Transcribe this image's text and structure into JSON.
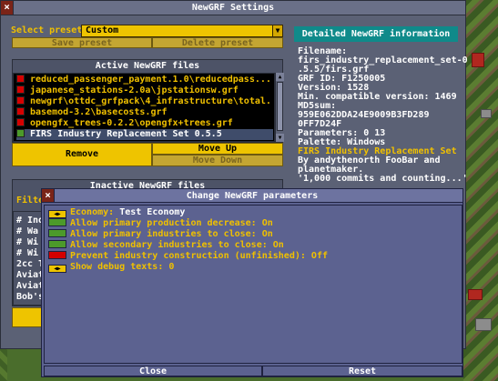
{
  "window": {
    "title": "NewGRF Settings",
    "close_glyph": "×"
  },
  "preset": {
    "label": "Select preset:",
    "value": "Custom",
    "save_label": "Save preset",
    "delete_label": "Delete preset"
  },
  "active": {
    "title": "Active NewGRF files",
    "items": [
      {
        "label": "reduced_passenger_payment.1.0\\reducedpass...",
        "status": "red"
      },
      {
        "label": "japanese_stations-2.0a\\jpstationsw.grf",
        "status": "red"
      },
      {
        "label": "newgrf\\ottdc_grfpack\\4_infrastructure\\total...",
        "status": "red"
      },
      {
        "label": "basemod-3.2\\basecosts.grf",
        "status": "red"
      },
      {
        "label": "opengfx_trees-0.2.2\\opengfx+trees.grf",
        "status": "red"
      },
      {
        "label": "FIRS Industry Replacement Set 0.5.5",
        "status": "green",
        "selected": true
      }
    ],
    "remove_label": "Remove",
    "move_up_label": "Move Up",
    "move_down_label": "Move Down"
  },
  "inactive": {
    "title": "Inactive NewGRF files",
    "filter_label": "Filter",
    "items": [
      "# Ind",
      "# Wa",
      "# Wi",
      "# Wi",
      "2cc T",
      "Aviat",
      "Aviat",
      "Bob's"
    ]
  },
  "info": {
    "title": "Detailed NewGRF information",
    "lines": [
      {
        "text": "Filename:",
        "style": "white"
      },
      {
        "text": "firs_industry_replacement_set-0",
        "style": "white"
      },
      {
        "text": ".5.5/firs.grf",
        "style": "white"
      },
      {
        "text": "GRF ID: F1250005",
        "style": "white"
      },
      {
        "text": "Version: 1528",
        "style": "white"
      },
      {
        "text": "Min. compatible version: 1469",
        "style": "white"
      },
      {
        "text": "MD5sum:",
        "style": "white"
      },
      {
        "text": "959E062DDA24E9009B3FD289",
        "style": "white"
      },
      {
        "text": "0FF7D24F",
        "style": "white"
      },
      {
        "text": "Parameters: 0 13",
        "style": "white"
      },
      {
        "text": "Palette: Windows",
        "style": "white"
      },
      {
        "text": "FIRS Industry Replacement Set",
        "style": "yellow"
      },
      {
        "text": "By andythenorth FooBar and",
        "style": "white"
      },
      {
        "text": "planetmaker.",
        "style": "white"
      },
      {
        "text": "'1,000 commits and counting...'",
        "style": "white"
      }
    ]
  },
  "params": {
    "title": "Change NewGRF parameters",
    "items": [
      {
        "name": "Economy:",
        "value": "Test Economy",
        "kind": "arrows"
      },
      {
        "name": "Allow primary production decrease:",
        "value": "On",
        "kind": "toggle",
        "color": "#4c9a2a"
      },
      {
        "name": "Allow primary industries to close:",
        "value": "On",
        "kind": "toggle",
        "color": "#4c9a2a"
      },
      {
        "name": "Allow secondary industries to close:",
        "value": "On",
        "kind": "toggle",
        "color": "#4c9a2a"
      },
      {
        "name": "Prevent industry construction (unfinished):",
        "value": "Off",
        "kind": "toggle",
        "color": "#d40000"
      },
      {
        "name": "Show debug texts:",
        "value": "0",
        "kind": "arrows"
      }
    ],
    "close_label": "Close",
    "reset_label": "Reset",
    "arrows_glyph": "◀▶"
  },
  "colors": {
    "accent_yellow": "#f0c000",
    "status_red": "#d40000",
    "status_green": "#4c9a2a",
    "info_header": "#0f8a8a"
  }
}
